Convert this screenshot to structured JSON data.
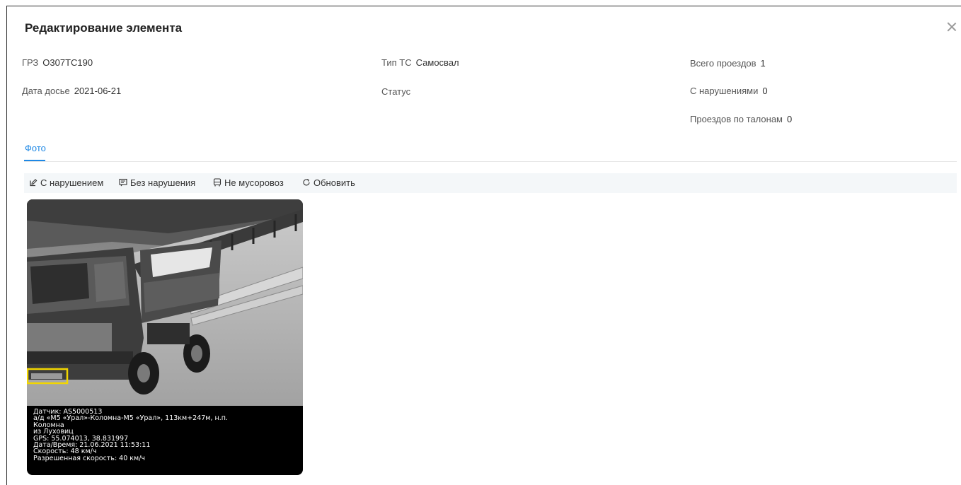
{
  "dialog": {
    "title": "Редактирование элемента",
    "close_icon": "close-icon"
  },
  "fields": {
    "grz": {
      "label": "ГРЗ",
      "value": "О307ТС190"
    },
    "dossier_date": {
      "label": "Дата досье",
      "value": "2021-06-21"
    },
    "vehicle_type": {
      "label": "Тип ТС",
      "value": "Самосвал"
    },
    "status": {
      "label": "Статус",
      "value": ""
    },
    "total_trips": {
      "label": "Всего проездов",
      "value": "1"
    },
    "violations": {
      "label": "С нарушениями",
      "value": "0"
    },
    "coupon_trips": {
      "label": "Проездов по талонам",
      "value": "0"
    }
  },
  "tabs": [
    {
      "label": "Фото",
      "active": true
    }
  ],
  "toolbar": {
    "with_violation": {
      "label": "С нарушением",
      "icon": "edit-icon"
    },
    "without_violation": {
      "label": "Без нарушения",
      "icon": "message-icon"
    },
    "not_garbage_truck": {
      "label": "Не мусоровоз",
      "icon": "bus-icon"
    },
    "refresh": {
      "label": "Обновить",
      "icon": "refresh-icon"
    }
  },
  "photo": {
    "caption": [
      "Датчик: AS5000513",
      "а/д «М5 «Урал»-Коломна-М5 «Урал», 113км+247м, н.п.",
      "Коломна",
      "из Луховиц",
      "GPS: 55.074013, 38.831997",
      "Дата/Время: 21.06.2021 11:53:11",
      "Скорость: 48 км/ч",
      "Разрешенная скорость: 40 км/ч"
    ]
  },
  "colors": {
    "accent": "#1e88e5",
    "plate_highlight": "#f2d600",
    "toolbar_bg": "#f4f7f9"
  }
}
